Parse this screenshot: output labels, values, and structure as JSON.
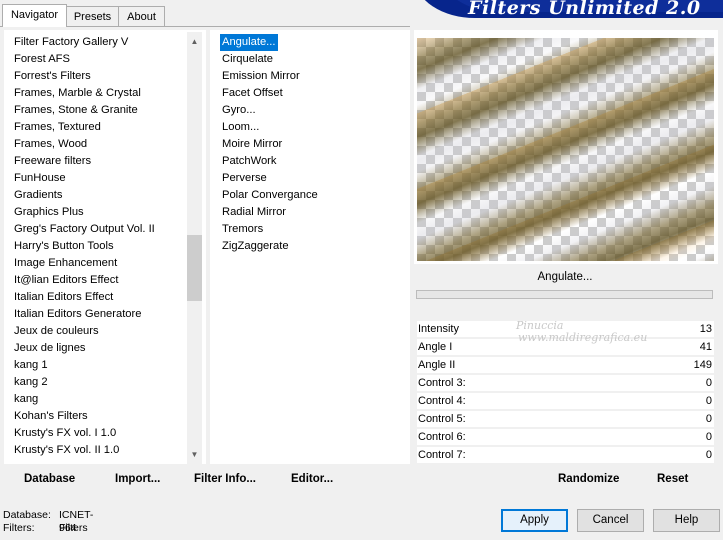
{
  "tabs": [
    {
      "label": "Navigator"
    },
    {
      "label": "Presets"
    },
    {
      "label": "About"
    }
  ],
  "title": "Filters Unlimited 2.0",
  "categories": [
    "Filter Factory Gallery V",
    "Forest AFS",
    "Forrest's Filters",
    "Frames, Marble & Crystal",
    "Frames, Stone & Granite",
    "Frames, Textured",
    "Frames, Wood",
    "Freeware filters",
    "FunHouse",
    "Gradients",
    "Graphics Plus",
    "Greg's Factory Output Vol. II",
    "Harry's Button Tools",
    "Image Enhancement",
    "It@lian Editors Effect",
    "Italian Editors Effect",
    "Italian Editors Generatore",
    "Jeux de couleurs",
    "Jeux de lignes",
    "kang 1",
    "kang 2",
    "kang",
    "Kohan's Filters",
    "Krusty's FX vol. I 1.0",
    "Krusty's FX vol. II 1.0"
  ],
  "filters": [
    "Angulate...",
    "Cirquelate",
    "Emission Mirror",
    "Facet Offset",
    "Gyro...",
    "Loom...",
    "Moire Mirror",
    "PatchWork",
    "Perverse",
    "Polar Convergance",
    "Radial Mirror",
    "Tremors",
    "ZigZaggerate"
  ],
  "selected_filter_label": "Angulate...",
  "controls": [
    {
      "name": "Intensity",
      "value": "13"
    },
    {
      "name": "Angle I",
      "value": "41"
    },
    {
      "name": "Angle II",
      "value": "149"
    },
    {
      "name": "Control 3:",
      "value": "0"
    },
    {
      "name": "Control 4:",
      "value": "0"
    },
    {
      "name": "Control 5:",
      "value": "0"
    },
    {
      "name": "Control 6:",
      "value": "0"
    },
    {
      "name": "Control 7:",
      "value": "0"
    }
  ],
  "left_buttons": {
    "database": "Database",
    "import": "Import...",
    "filter_info": "Filter Info...",
    "editor": "Editor..."
  },
  "right_buttons": {
    "randomize": "Randomize",
    "reset": "Reset"
  },
  "status": {
    "database_label": "Database:",
    "database_value": "ICNET-Filters",
    "filters_label": "Filters:",
    "filters_value": "964"
  },
  "dialog_buttons": {
    "apply": "Apply",
    "cancel": "Cancel",
    "help": "Help"
  },
  "watermark": {
    "line1": "Pinuccia",
    "line2": "www.maldiregrafica.eu"
  },
  "colors": {
    "selection": "#0078d7",
    "banner": "#07258c"
  }
}
